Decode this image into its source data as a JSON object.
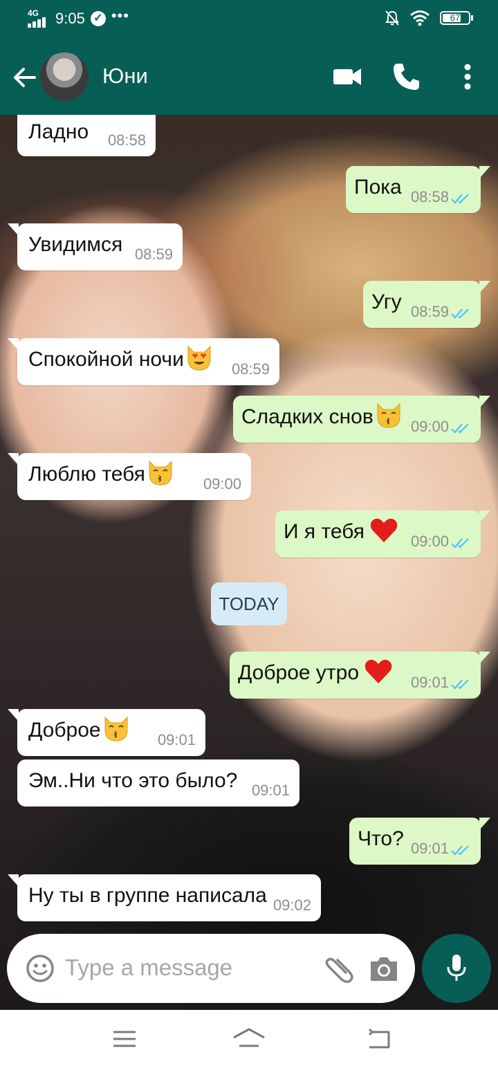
{
  "status_bar": {
    "network": "4G",
    "time": "9:05",
    "battery": "67",
    "dots": "•••"
  },
  "header": {
    "contact_name": "Юни",
    "back_icon": "arrow-left-icon",
    "video_icon": "video-call-icon",
    "call_icon": "phone-icon",
    "menu_icon": "more-vert-icon"
  },
  "messages": [
    {
      "dir": "in",
      "text": "Ладно",
      "time": "08:58"
    },
    {
      "dir": "out",
      "text": "Пока",
      "time": "08:58"
    },
    {
      "dir": "in",
      "text": "Увидимся",
      "time": "08:59"
    },
    {
      "dir": "out",
      "text": "Угу",
      "time": "08:59"
    },
    {
      "dir": "in",
      "text": "Спокойной ночи",
      "emoji": "heart-eyes-cat",
      "time": "08:59"
    },
    {
      "dir": "out",
      "text": "Сладких снов",
      "emoji": "kissing-cat",
      "time": "09:00"
    },
    {
      "dir": "in",
      "text": "Люблю тебя",
      "emoji": "kissing-cat",
      "time": "09:00"
    },
    {
      "dir": "out",
      "text": "И я тебя",
      "emoji": "red-heart",
      "time": "09:00"
    },
    {
      "dir": "out",
      "text": "Доброе утро",
      "emoji": "red-heart",
      "time": "09:01"
    },
    {
      "dir": "in",
      "text": "Доброе",
      "emoji": "kissing-cat",
      "time": "09:01"
    },
    {
      "dir": "in",
      "text": "Эм..Ни что это было?",
      "time": "09:01"
    },
    {
      "dir": "out",
      "text": "Что?",
      "time": "09:01"
    },
    {
      "dir": "in",
      "text": "Ну ты в группе написала",
      "time": "09:02"
    }
  ],
  "date_divider": "TODAY",
  "input": {
    "placeholder": "Type a message",
    "emoji_icon": "smiley-icon",
    "attach_icon": "paperclip-icon",
    "camera_icon": "camera-icon",
    "mic_icon": "microphone-icon"
  },
  "colors": {
    "header": "#075e54",
    "outgoing_bubble": "#dcf8c6",
    "incoming_bubble": "#ffffff",
    "date_chip": "#d6ebf8",
    "read_ticks": "#4fc3f7"
  },
  "nav_bar": {
    "menu_icon": "hamburger-icon",
    "home_icon": "home-icon",
    "back_icon": "back-nav-icon"
  }
}
